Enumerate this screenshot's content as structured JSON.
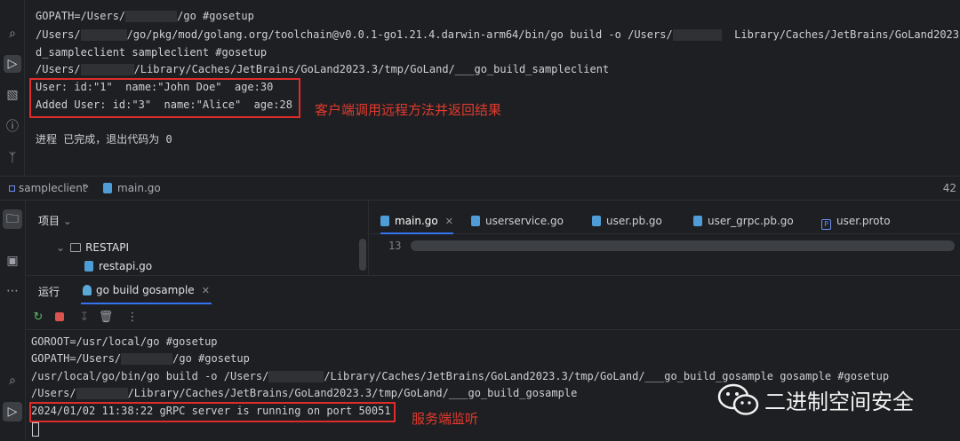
{
  "upper_console": {
    "lines": [
      {
        "a": "GOPATH=/Users/",
        "b": "/go #gosetup"
      },
      {
        "a": "/Users/",
        "b": "/go/pkg/mod/golang.org/toolchain@v0.0.1-go1.21.4.darwin-arm64/bin/go build -o /Users/",
        "c": "Library/Caches/JetBrains/GoLand2023."
      },
      {
        "a": "d_sampleclient sampleclient #gosetup"
      },
      {
        "a": "/Users/",
        "b": "/Library/Caches/JetBrains/GoLand2023.3/tmp/GoLand/___go_build_sampleclient"
      },
      {
        "a": "User: id:\"1\"  name:\"John Doe\"  age:30"
      },
      {
        "a": "Added User: id:\"3\"  name:\"Alice\"  age:28"
      },
      {
        "a": "进程 已完成，退出代码为 0"
      }
    ],
    "annotation": "客户端调用远程方法并返回结果"
  },
  "breadcrumb": {
    "items": [
      "sampleclient",
      "main.go"
    ],
    "separator": "›",
    "line_number": "42"
  },
  "project_panel": {
    "title": "项目",
    "folder": "RESTAPI",
    "file": "restapi.go"
  },
  "editor": {
    "tabs": [
      {
        "label": "main.go",
        "kind": "go",
        "active": true,
        "closable": true
      },
      {
        "label": "userservice.go",
        "kind": "go"
      },
      {
        "label": "user.pb.go",
        "kind": "go"
      },
      {
        "label": "user_grpc.pb.go",
        "kind": "go"
      },
      {
        "label": "user.proto",
        "kind": "proto"
      }
    ],
    "visible_line": "13"
  },
  "run_panel": {
    "label": "运行",
    "tab": "go build gosample",
    "console": [
      {
        "a": "GOROOT=/usr/local/go #gosetup"
      },
      {
        "a": "GOPATH=/Users/",
        "b": "/go #gosetup"
      },
      {
        "a": "/usr/local/go/bin/go build -o /Users/",
        "b": "/Library/Caches/JetBrains/GoLand2023.3/tmp/GoLand/___go_build_gosample gosample #gosetup"
      },
      {
        "a": "/Users/",
        "b": "/Library/Caches/JetBrains/GoLand2023.3/tmp/GoLand/___go_build_gosample"
      },
      {
        "a": "2024/01/02 11:38:22 gRPC server is running on port 50051"
      }
    ],
    "annotation": "服务端监听"
  },
  "watermark": {
    "text": "二进制空间安全"
  },
  "icons": {
    "top_stripe": [
      "debug-icon",
      "run-icon",
      "terminal-icon",
      "problems-icon",
      "git-icon"
    ],
    "left_stripe": [
      "project-folder-icon",
      "structure-icon",
      "more-icon",
      "debug-icon",
      "run-icon"
    ],
    "run_toolbar": [
      "rerun-icon",
      "stop-icon",
      "scroll-to-end-icon",
      "clear-icon",
      "more-options-icon"
    ]
  },
  "colors": {
    "background": "#1e1f22",
    "annotation_red": "#e23a2e",
    "accent_blue": "#3574f0"
  }
}
